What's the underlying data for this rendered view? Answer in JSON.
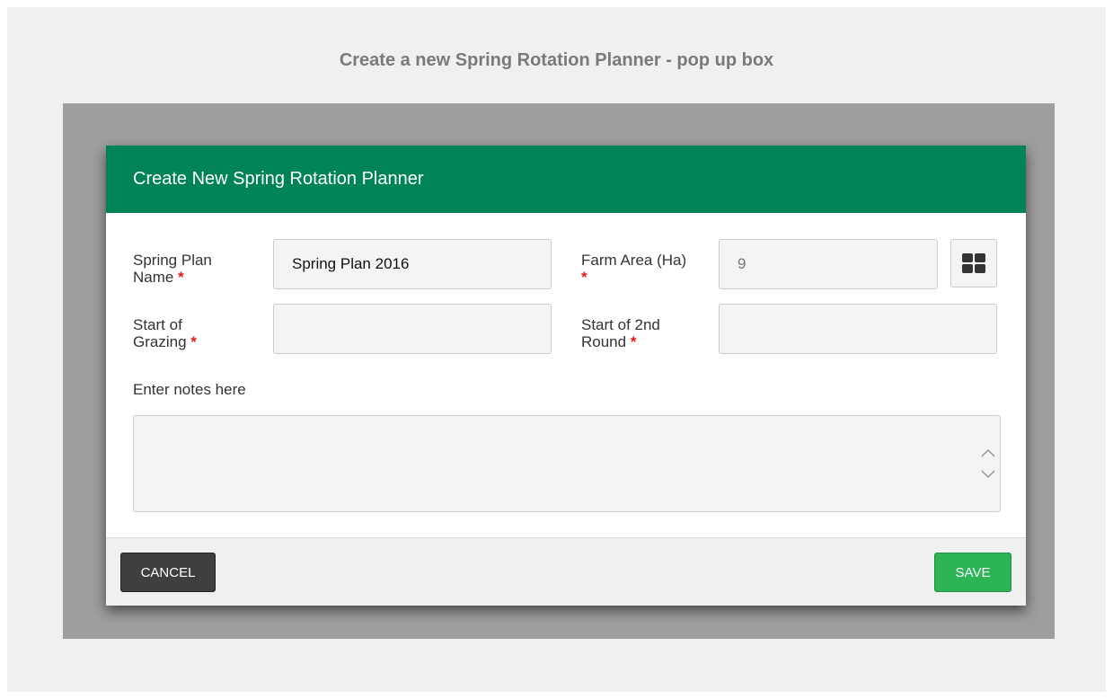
{
  "page": {
    "heading": "Create a new Spring Rotation Planner - pop up box"
  },
  "dialog": {
    "title": "Create New Spring Rotation Planner",
    "fields": {
      "spring_plan_name": {
        "label_line1": "Spring Plan",
        "label_line2": "Name",
        "value": "Spring Plan 2016"
      },
      "farm_area": {
        "label_line1": "Farm Area (Ha)",
        "label_line2": "",
        "value": "9"
      },
      "start_of_grazing": {
        "label_line1": "Start of",
        "label_line2": "Grazing",
        "value": ""
      },
      "start_of_2nd_round": {
        "label_line1": "Start of 2nd",
        "label_line2": "Round",
        "value": ""
      }
    },
    "required_marker": "*",
    "notes_label": "Enter notes here",
    "notes_value": "",
    "grid_button_icon": "grid-icon",
    "cancel_label": "CANCEL",
    "save_label": "SAVE"
  },
  "colors": {
    "header": "#008357",
    "required": "#e21b1b",
    "cancel": "#3f3f3f",
    "save": "#2db457"
  }
}
